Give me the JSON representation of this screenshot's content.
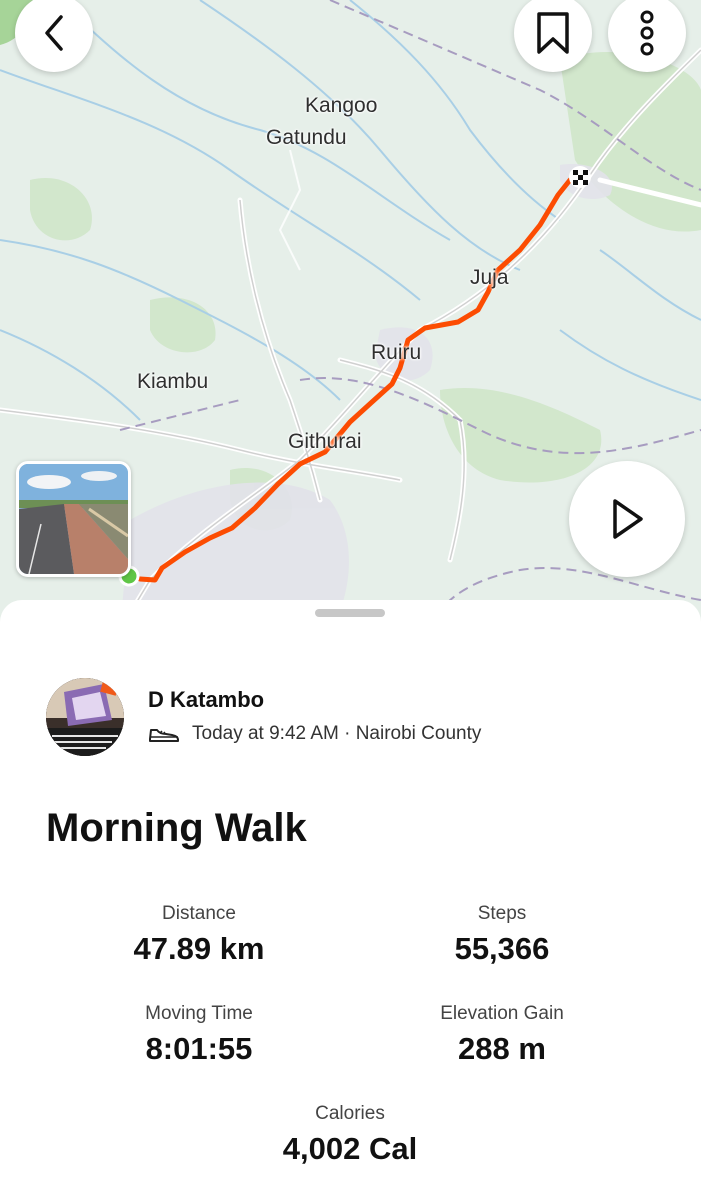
{
  "map": {
    "places": [
      "Kangoo",
      "Gatundu",
      "Juja",
      "Ruiru",
      "Kiambu",
      "Githurai"
    ],
    "route_color": "#fc4c02",
    "start_color": "#5fc646"
  },
  "controls": {
    "back_icon": "chevron-left-icon",
    "bookmark_icon": "bookmark-icon",
    "more_icon": "more-vertical-icon",
    "play_icon": "play-icon"
  },
  "activity": {
    "athlete_name": "D Katambo",
    "activity_icon": "shoe-icon",
    "meta": "Today at 9:42 AM · Nairobi County",
    "title": "Morning Walk",
    "stats": [
      {
        "label": "Distance",
        "value": "47.89 km"
      },
      {
        "label": "Steps",
        "value": "55,366"
      },
      {
        "label": "Moving Time",
        "value": "8:01:55"
      },
      {
        "label": "Elevation Gain",
        "value": "288 m"
      },
      {
        "label": "Calories",
        "value": "4,002 Cal"
      }
    ]
  }
}
